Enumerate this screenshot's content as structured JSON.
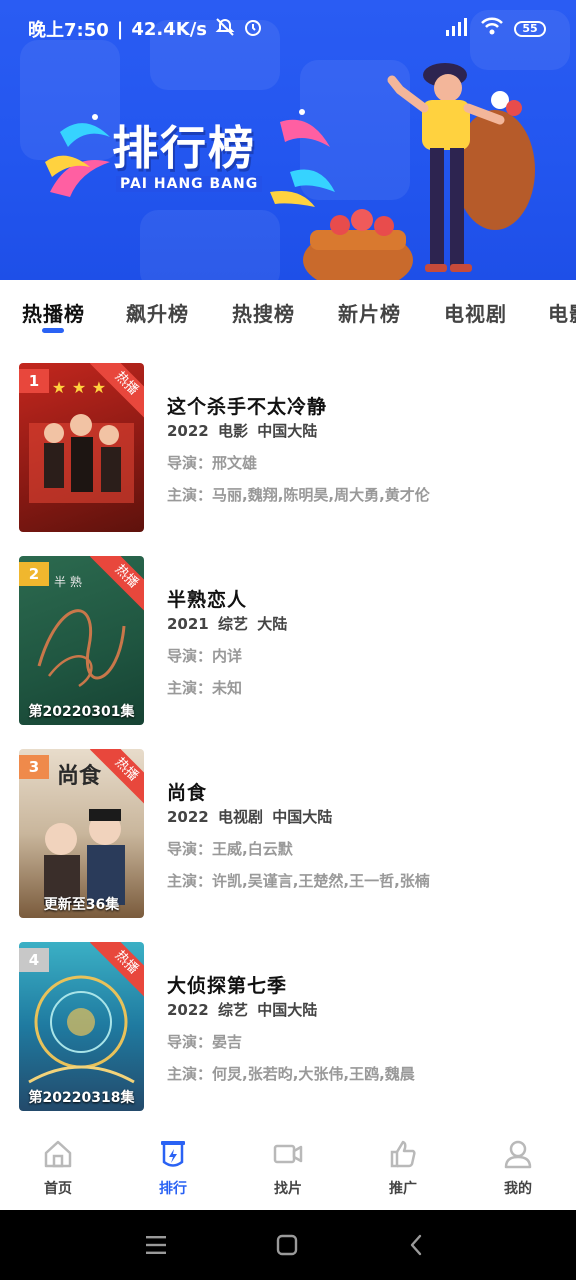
{
  "status_bar": {
    "time": "晚上7:50",
    "net_speed": "42.4K/s",
    "battery": "55"
  },
  "banner": {
    "title": "排行榜",
    "subtitle": "PAI HANG BANG"
  },
  "tabs": [
    {
      "label": "热播榜",
      "active": true
    },
    {
      "label": "飙升榜",
      "active": false
    },
    {
      "label": "热搜榜",
      "active": false
    },
    {
      "label": "新片榜",
      "active": false
    },
    {
      "label": "电视剧",
      "active": false
    },
    {
      "label": "电影",
      "active": false
    }
  ],
  "list": [
    {
      "rank": "1",
      "badge": "热播",
      "title": "这个杀手不太冷静",
      "meta": "2022 电影 中国大陆",
      "director": "导演：邢文雄",
      "cast": "主演：马丽,魏翔,陈明昊,周大勇,黄才伦",
      "episode": "",
      "rank_color": "#e8473c"
    },
    {
      "rank": "2",
      "badge": "热播",
      "title": "半熟恋人",
      "meta": "2021 综艺 大陆",
      "director": "导演：内详",
      "cast": "主演：未知",
      "episode": "第20220301集",
      "rank_color": "#f0b72e"
    },
    {
      "rank": "3",
      "badge": "热播",
      "title": "尚食",
      "meta": "2022 电视剧 中国大陆",
      "director": "导演：王威,白云默",
      "cast": "主演：许凯,吴谨言,王楚然,王一哲,张楠",
      "episode": "更新至36集",
      "rank_color": "#ef8a4b"
    },
    {
      "rank": "4",
      "badge": "热播",
      "title": "大侦探第七季",
      "meta": "2022 综艺 中国大陆",
      "director": "导演：晏吉",
      "cast": "主演：何炅,张若昀,大张伟,王鸥,魏晨",
      "episode": "第20220318集",
      "rank_color": "#c8c8c8"
    }
  ],
  "bottom_nav": [
    {
      "label": "首页",
      "icon": "home-icon",
      "active": false
    },
    {
      "label": "排行",
      "icon": "ranking-icon",
      "active": true
    },
    {
      "label": "找片",
      "icon": "video-camera-icon",
      "active": false
    },
    {
      "label": "推广",
      "icon": "thumbs-up-icon",
      "active": false
    },
    {
      "label": "我的",
      "icon": "user-icon",
      "active": false
    }
  ],
  "colors": {
    "accent": "#2a62f4",
    "banner_bg": "#2356ef",
    "hot_badge": "#e8473c"
  }
}
